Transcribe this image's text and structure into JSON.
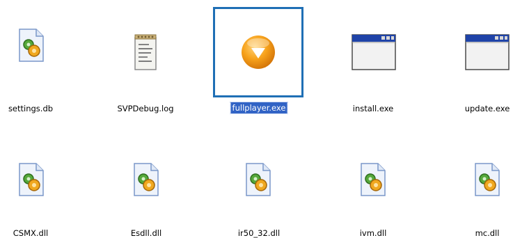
{
  "file_view": {
    "items": [
      {
        "name": "settings.db",
        "icon": "dll-gear-document-icon",
        "selected": false
      },
      {
        "name": "SVPDebug.log",
        "icon": "notepad-text-document-icon",
        "selected": false
      },
      {
        "name": "fullplayer.exe",
        "icon": "orange-play-app-icon",
        "selected": true
      },
      {
        "name": "install.exe",
        "icon": "window-app-icon",
        "selected": false
      },
      {
        "name": "update.exe",
        "icon": "window-app-icon",
        "selected": false
      },
      {
        "name": "CSMX.dll",
        "icon": "dll-gear-document-icon",
        "selected": false
      },
      {
        "name": "Esdll.dll",
        "icon": "dll-gear-document-icon",
        "selected": false
      },
      {
        "name": "ir50_32.dll",
        "icon": "dll-gear-document-icon",
        "selected": false
      },
      {
        "name": "ivm.dll",
        "icon": "dll-gear-document-icon",
        "selected": false
      },
      {
        "name": "mc.dll",
        "icon": "dll-gear-document-icon",
        "selected": false
      }
    ],
    "colors": {
      "selection_border": "#1f6fb5",
      "selection_label_bg": "#3163c5",
      "label_text": "#000000"
    }
  }
}
